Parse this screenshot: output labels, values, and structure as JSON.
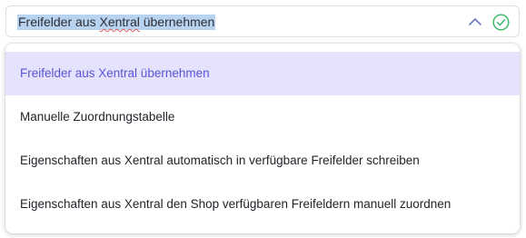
{
  "select": {
    "value_before": "Freifelder aus ",
    "value_misspelled": "Xentral",
    "value_after": " übernehmen",
    "expanded_icon": "chevron-up-icon",
    "status_icon": "check-circle-icon"
  },
  "dropdown": {
    "options": [
      {
        "label": "Freifelder aus Xentral übernehmen",
        "selected": true
      },
      {
        "label": "Manuelle Zuordnungstabelle",
        "selected": false
      },
      {
        "label": "Eigenschaften aus Xentral automatisch in verfügbare Freifelder schreiben",
        "selected": false
      },
      {
        "label": "Eigenschaften aus Xentral den Shop verfügbaren Freifeldern manuell zuordnen",
        "selected": false
      }
    ]
  },
  "colors": {
    "accent": "#5a55d8",
    "selected_option_bg": "#e4e2fc",
    "text_selection_bg": "#b8d3f0",
    "success_green": "#3fb86f",
    "chevron_blue": "#6a78c8"
  }
}
